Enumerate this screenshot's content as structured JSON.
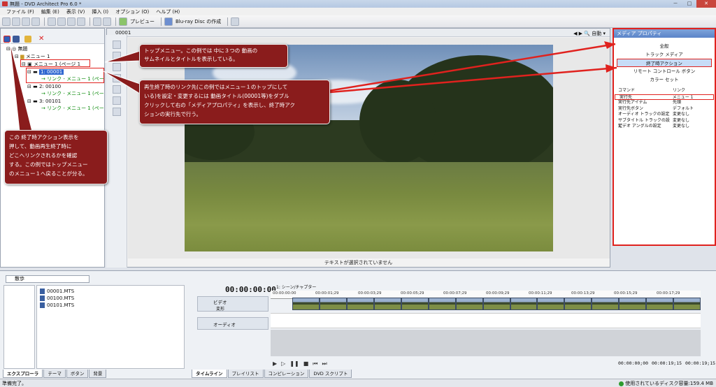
{
  "window": {
    "title": "無題 - DVD Architect Pro 6.0 *",
    "controls": [
      "－",
      "□",
      "✕"
    ]
  },
  "menu": [
    "ファイル (F)",
    "編集 (E)",
    "表示 (V)",
    "挿入 (I)",
    "オプション (O)",
    "ヘルプ (H)"
  ],
  "toolbar": {
    "preview_label": "プレビュー",
    "burn_label": "Blu-ray Disc の作成"
  },
  "tree": {
    "root": "無題",
    "menu1": "メニュー 1",
    "page1": "メニュー 1 (ページ 1",
    "items": [
      {
        "label": "1: 00001",
        "link": "リンク - メニュー 1 (ペー"
      },
      {
        "label": "2: 00100",
        "link": "リンク - メニュー 1 (ペー"
      },
      {
        "label": "3: 00101",
        "link": "リンク - メニュー 1 (ペー"
      }
    ]
  },
  "preview": {
    "tab_label": "00001",
    "zoom_label": "自動",
    "status_text": "テキストが選択されていません"
  },
  "properties": {
    "header": "メディア プロパティ",
    "tabs": [
      "全般",
      "トラック メディア",
      "終了時アクション",
      "リモート コントロール ボタン",
      "カラー セット"
    ],
    "active_tab": "終了時アクション",
    "columns": {
      "key": "コマンド",
      "value": "リンク"
    },
    "rows": [
      {
        "key": "実行先",
        "value": "メニュー 1"
      },
      {
        "key": "実行先アイテム",
        "value": "先頭"
      },
      {
        "key": "実行先ボタン",
        "value": "デフォルト"
      },
      {
        "key": "オーディオ トラックの設定",
        "value": "変更なし"
      },
      {
        "key": "サブタイトル トラックの設定",
        "value": "変更なし"
      },
      {
        "key": "ビデオ アングルの設定",
        "value": "変更なし"
      }
    ]
  },
  "callouts": {
    "top_menu": "トップメニュー。この例では 中に３つの 動画の\nサムネイルとタイトルを表示している。",
    "link_target": "再生終了時のリンク先(この例ではメニュー１のトップにして\nいる)を設定・変更するには 動画タイトル(00001等)をダブル\nクリックして右の「メディアプロパティ」を表示し、終了時アク\nションの実行先で行う。",
    "end_action": "この 終了時アクション表示を\n押して、動画再生終了時に\nどこへリンクされるかを確認\nする。この例ではトップメニュー\nのメニュー１へ戻ることが分る。"
  },
  "explorer": {
    "folder": "散歩",
    "files": [
      "00001.MTS",
      "00100.MTS",
      "00101.MTS"
    ],
    "tabs": [
      "エクスプローラ",
      "テーマ",
      "ボタン",
      "背景"
    ]
  },
  "timeline": {
    "timecode": "00:00:00:00",
    "marker_label": "1: シーン/チャプター",
    "video_track": "ビデオ",
    "shape_label": "変形",
    "audio_track": "オーディオ",
    "ruler": [
      "00:00:00:00",
      "00:00:01;29",
      "00:00:03;29",
      "00:00:05;29",
      "00:00:07;29",
      "00:00:09;29",
      "00:00:11;29",
      "00:00:13;29",
      "00:00:15;29",
      "00:00:17;29"
    ],
    "tabs": [
      "タイムライン",
      "プレイリスト",
      "コンピレーション",
      "DVD スクリプト"
    ],
    "tc_start": "00:00:00;00",
    "tc_end": "00:00:19;15",
    "tc_length": "00:00:19;15"
  },
  "status": {
    "left": "準備完了。",
    "right": "使用されているディスク容量:159.4 MB"
  }
}
